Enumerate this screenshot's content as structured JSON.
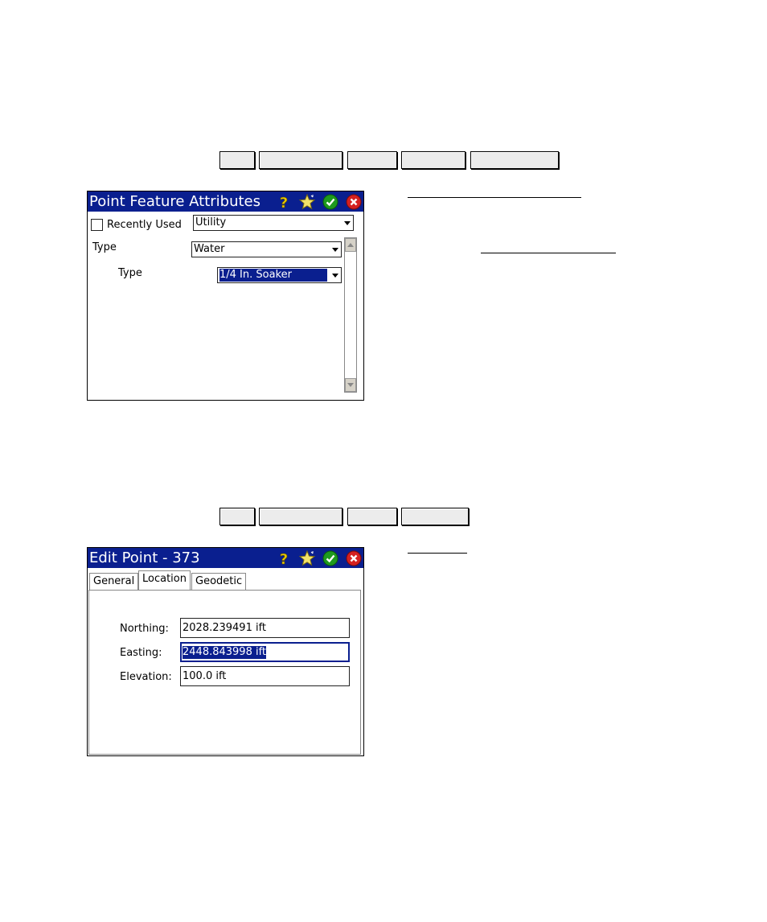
{
  "dialog1": {
    "title": "Point Feature Attributes",
    "recently_used_label": "Recently Used",
    "recently_used_checked": false,
    "category_value": "Utility",
    "type_label": "Type",
    "type_value": "Water",
    "subtype_label": "Type",
    "subtype_value": "1/4 In. Soaker"
  },
  "dialog2": {
    "title": "Edit Point - 373",
    "tabs": [
      {
        "label": "General",
        "active": false
      },
      {
        "label": "Location",
        "active": true
      },
      {
        "label": "Geodetic",
        "active": false
      }
    ],
    "northing_label": "Northing:",
    "northing_value": "2028.239491 ift",
    "easting_label": "Easting:",
    "easting_value": "2448.843998 ift",
    "elevation_label": "Elevation:",
    "elevation_value": "100.0 ift"
  },
  "titlebar_icons": [
    "help-icon",
    "favorite-star-icon",
    "ok-check-icon",
    "close-x-icon"
  ],
  "colors": {
    "titlebar": "#0a1f8f",
    "selection": "#0a1f8f",
    "ok_green": "#1e9a1e",
    "close_red": "#d42020",
    "help_yellow": "#e8c800"
  }
}
